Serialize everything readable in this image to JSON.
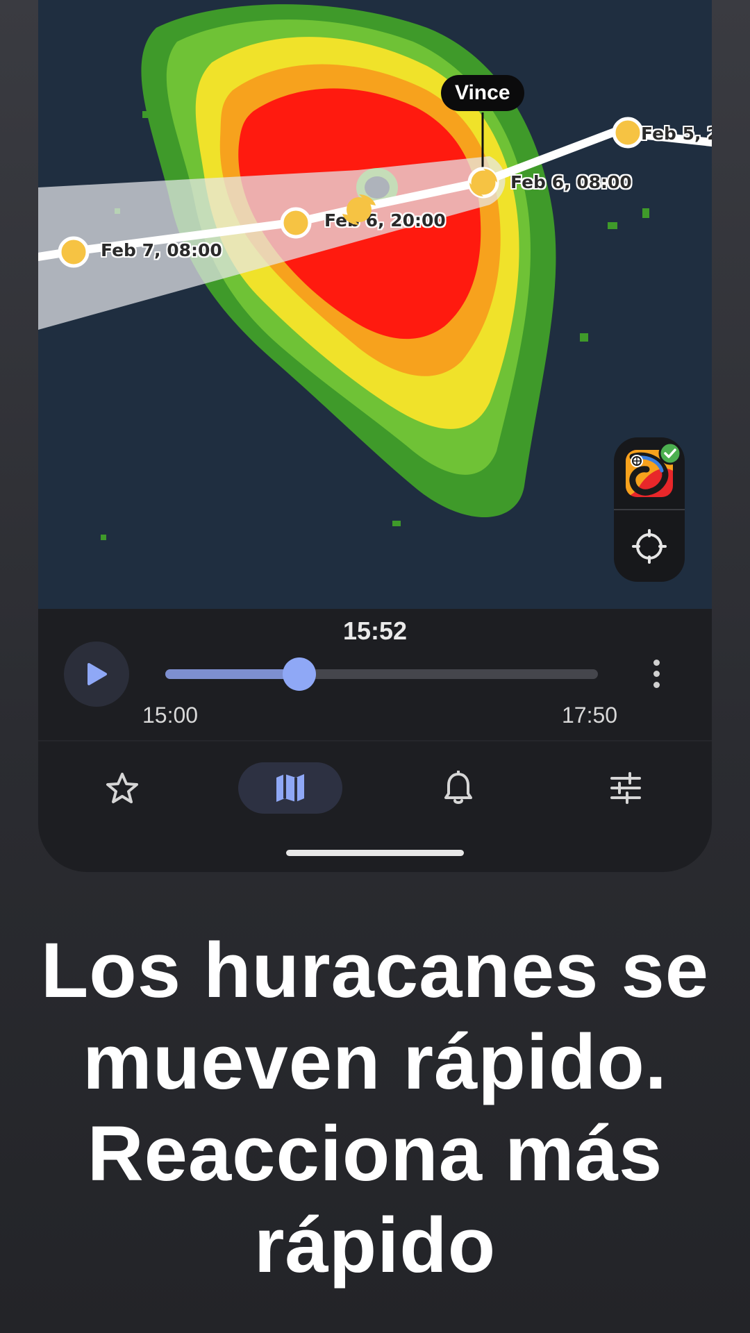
{
  "map": {
    "storm_name": "Vince",
    "track_points": [
      {
        "label": "Feb 5, 2"
      },
      {
        "label": "Feb 6, 08:00"
      },
      {
        "label": "Feb 6, 20:00"
      },
      {
        "label": "Feb 7, 08:00"
      }
    ],
    "layer_icon": "radar-layer-icon",
    "locate_icon": "crosshair-icon"
  },
  "player": {
    "current_time": "15:52",
    "start_time": "15:00",
    "end_time": "17:50",
    "progress": 0.31,
    "play_icon": "play-icon",
    "more_icon": "more-vertical-icon"
  },
  "nav": {
    "items": [
      {
        "icon": "star-icon",
        "active": false
      },
      {
        "icon": "map-icon",
        "active": true
      },
      {
        "icon": "bell-icon",
        "active": false
      },
      {
        "icon": "settings-sliders-icon",
        "active": false
      }
    ],
    "accent": "#8fa8f6"
  },
  "headline": {
    "line1": "Los huracanes se",
    "line2": "mueven rápido.",
    "line3": "Reacciona más",
    "line4": "rápido"
  }
}
